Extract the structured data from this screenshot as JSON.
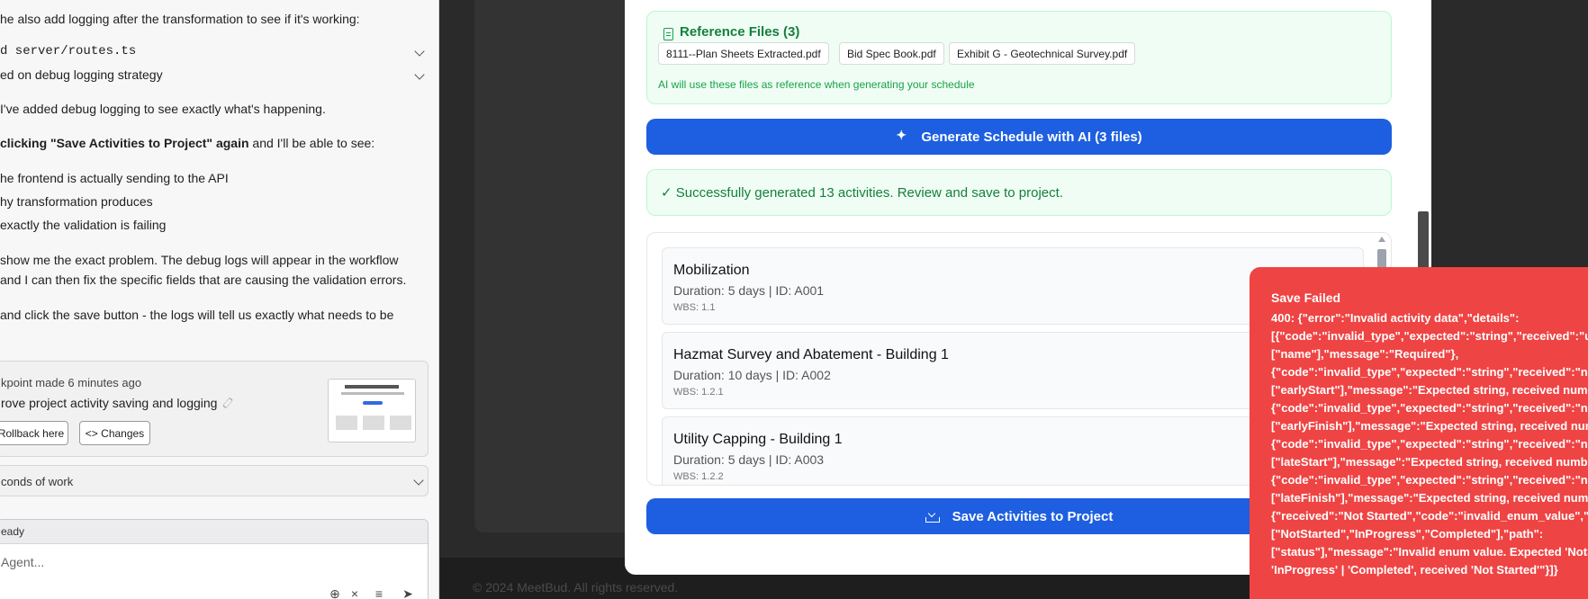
{
  "chat": {
    "intro_line": "he also add logging after the transformation to see if it's working:",
    "collapsibles": [
      {
        "label": "d server/routes.ts"
      },
      {
        "label": "ed on debug logging strategy"
      }
    ],
    "para1": "I've added debug logging to see exactly what's happening.",
    "para2_bold": "clicking \"Save Activities to Project\" again",
    "para2_rest": " and I'll be able to see:",
    "bullets": [
      "he frontend is actually sending to the API",
      "hy transformation produces",
      "exactly the validation is failing"
    ],
    "para3_l1": "show me the exact problem. The debug logs will appear in the workflow",
    "para3_l2": "and I can then fix the specific fields that are causing the validation errors.",
    "para4": " and click the save button - the logs will tell us exactly what needs to be",
    "checkpoint": {
      "meta": "kpoint made 6 minutes ago",
      "title": "rove project activity saving and logging",
      "rollback_label": "Rollback here",
      "changes_label": "<> Changes"
    },
    "work_label": "conds of work",
    "status": "eady",
    "input_placeholder": " Agent...",
    "tools": {
      "globe": "⊕",
      "close": "×",
      "sliders": "≡",
      "send": "➤"
    }
  },
  "dialog": {
    "ref_title": "Reference Files (3)",
    "ref_files": [
      "8111--Plan Sheets Extracted.pdf",
      "Bid Spec Book.pdf",
      "Exhibit G - Geotechnical Survey.pdf"
    ],
    "ref_note": "AI will use these files as reference when generating your schedule",
    "generate_label": "Generate Schedule with AI (3 files)",
    "success_text": "✓ Successfully generated 13 activities. Review and save to project.",
    "activities": [
      {
        "name": "Mobilization",
        "duration": "Duration: 5 days | ID: A001",
        "wbs": "WBS: 1.1"
      },
      {
        "name": "Hazmat Survey and Abatement - Building 1",
        "duration": "Duration: 10 days | ID: A002",
        "wbs": "WBS: 1.2.1"
      },
      {
        "name": "Utility Capping - Building 1",
        "duration": "Duration: 5 days | ID: A003",
        "wbs": "WBS: 1.2.2"
      }
    ],
    "save_label": "Save Activities to Project"
  },
  "footer": {
    "text": "© 2024 MeetBud. All rights reserved."
  },
  "toast": {
    "title": "Save Failed",
    "lines": [
      "400: {\"error\":\"Invalid activity data\",\"details\":",
      "[{\"code\":\"invalid_type\",\"expected\":\"string\",\"received\":\"undefi",
      "[\"name\"],\"message\":\"Required\"},",
      "{\"code\":\"invalid_type\",\"expected\":\"string\",\"received\":\"numbe",
      "[\"earlyStart\"],\"message\":\"Expected string, received number\"",
      "{\"code\":\"invalid_type\",\"expected\":\"string\",\"received\":\"numbe",
      "[\"earlyFinish\"],\"message\":\"Expected string, received number",
      "{\"code\":\"invalid_type\",\"expected\":\"string\",\"received\":\"numbe",
      "[\"lateStart\"],\"message\":\"Expected string, received number\"},",
      "{\"code\":\"invalid_type\",\"expected\":\"string\",\"received\":\"numbe",
      "[\"lateFinish\"],\"message\":\"Expected string, received number\"}",
      "{\"received\":\"Not Started\",\"code\":\"invalid_enum_value\",\"opti",
      "[\"NotStarted\",\"InProgress\",\"Completed\"],\"path\":",
      "[\"status\"],\"message\":\"Invalid enum value. Expected 'NotStarted'",
      "'InProgress' | 'Completed', received 'Not Started'\"}]}"
    ]
  },
  "colors": {
    "primary": "#1d5fe0",
    "success_bg": "#f0fdf4",
    "success_text": "#15803d",
    "error_bg": "#ef4444",
    "dark_bg": "#2a2a2a"
  }
}
